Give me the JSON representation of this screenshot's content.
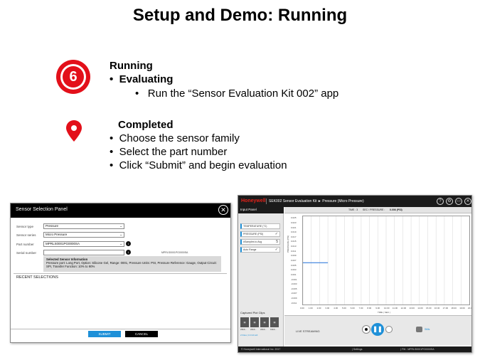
{
  "slide": {
    "title": "Setup and Demo: Running"
  },
  "step": {
    "number": "6",
    "heading": "Running",
    "bullet_1": "Evaluating",
    "sub_bullet_1": "Run the “Sensor Evaluation Kit 002” app"
  },
  "completed": {
    "heading": "Completed",
    "bullets": [
      "Choose the sensor family",
      "Select the part number",
      "Click “Submit” and begin evaluation"
    ]
  },
  "sensor_panel": {
    "title": "Sensor Selection Panel",
    "close_glyph": "✕",
    "labels": {
      "sensor_type": "Sensor type",
      "sensor_series": "Sensor series",
      "part_number": "Part number",
      "serial_number": "Serial number"
    },
    "values": {
      "sensor_type": "Pressure",
      "sensor_series": "Micro Pressure",
      "part_number": "MPRLS0001PG0000SA",
      "serial_number": ""
    },
    "part_ref": "MPRLS0001PG0000SA",
    "info_heading": "Selected Sensor Information",
    "info_text": "Pressure port: Long Port, Option: Silicone Gel, Range: 0001, Pressure Units: PSI, Pressure Reference: Gauge, Output Circuit: SPI, Transfer Function: 10% to 90%",
    "recent_heading": "RECENT SELECTIONS",
    "submit_label": "SUBMIT",
    "cancel_label": "CANCEL"
  },
  "app": {
    "brand": "Honeywell",
    "title": "SEK002 Sensor Evaluation Kit  ►  Pressure (Micro Pressure)",
    "panel_title": "Input Panel",
    "channels": [
      {
        "label": "TEMPERATURE (°C)",
        "check": ""
      },
      {
        "label": "PRESSURE (PSI)",
        "check": "✓"
      },
      {
        "label": "#Samples to Avg",
        "check": "5"
      },
      {
        "label": "Auto Range",
        "check": "✓"
      }
    ],
    "header_time": "TIME :  3",
    "header_sec": "SEC  /  PRESSURE :",
    "header_value": "0.006 (PSI)",
    "y_ticks": [
      "0.025",
      "0.023",
      "0.021",
      "0.019",
      "0.017",
      "0.015",
      "0.013",
      "0.011",
      "0.009",
      "0.007",
      "0.005",
      "0.003",
      "0.001",
      "-0.001",
      "-0.003",
      "-0.005",
      "-0.007",
      "-0.009",
      "-0.011"
    ],
    "x_ticks": [
      "0.00",
      "1.00",
      "2.00",
      "3.00",
      "4.00",
      "5.00",
      "6.00",
      "7.00",
      "8.00",
      "9.00",
      "10.00",
      "11.00",
      "12.00",
      "13.00",
      "14.00",
      "15.00",
      "16.00",
      "17.00",
      "18.00",
      "19.00",
      "20.0"
    ],
    "y_axis_label": "PRESSURE (PSI)",
    "x_axis_label": "TIME ( SEC )",
    "clips_title": "Captured Plot Clips",
    "clips": [
      "23kb...",
      "22kb...",
      "22kb...",
      "19kb..."
    ],
    "clip_footer": "2 Files  |  0.0 kb left",
    "live_label": "LIVE STREAMING",
    "pause_glyph": "❚❚",
    "cam_label": "Stills",
    "status_left": "© Honeywell International Inc. 2017",
    "status_mid": "|  Settings",
    "status_right": "|  FW :  MPRLS0001PG0000SA",
    "chart_data": {
      "type": "line",
      "title": "",
      "xlabel": "TIME ( SEC )",
      "ylabel": "PRESSURE (PSI)",
      "xlim": [
        0,
        20
      ],
      "ylim": [
        -0.012,
        0.026
      ],
      "series": [
        {
          "x": [
            0,
            3
          ],
          "values": [
            0.006,
            0.006
          ]
        }
      ]
    }
  }
}
